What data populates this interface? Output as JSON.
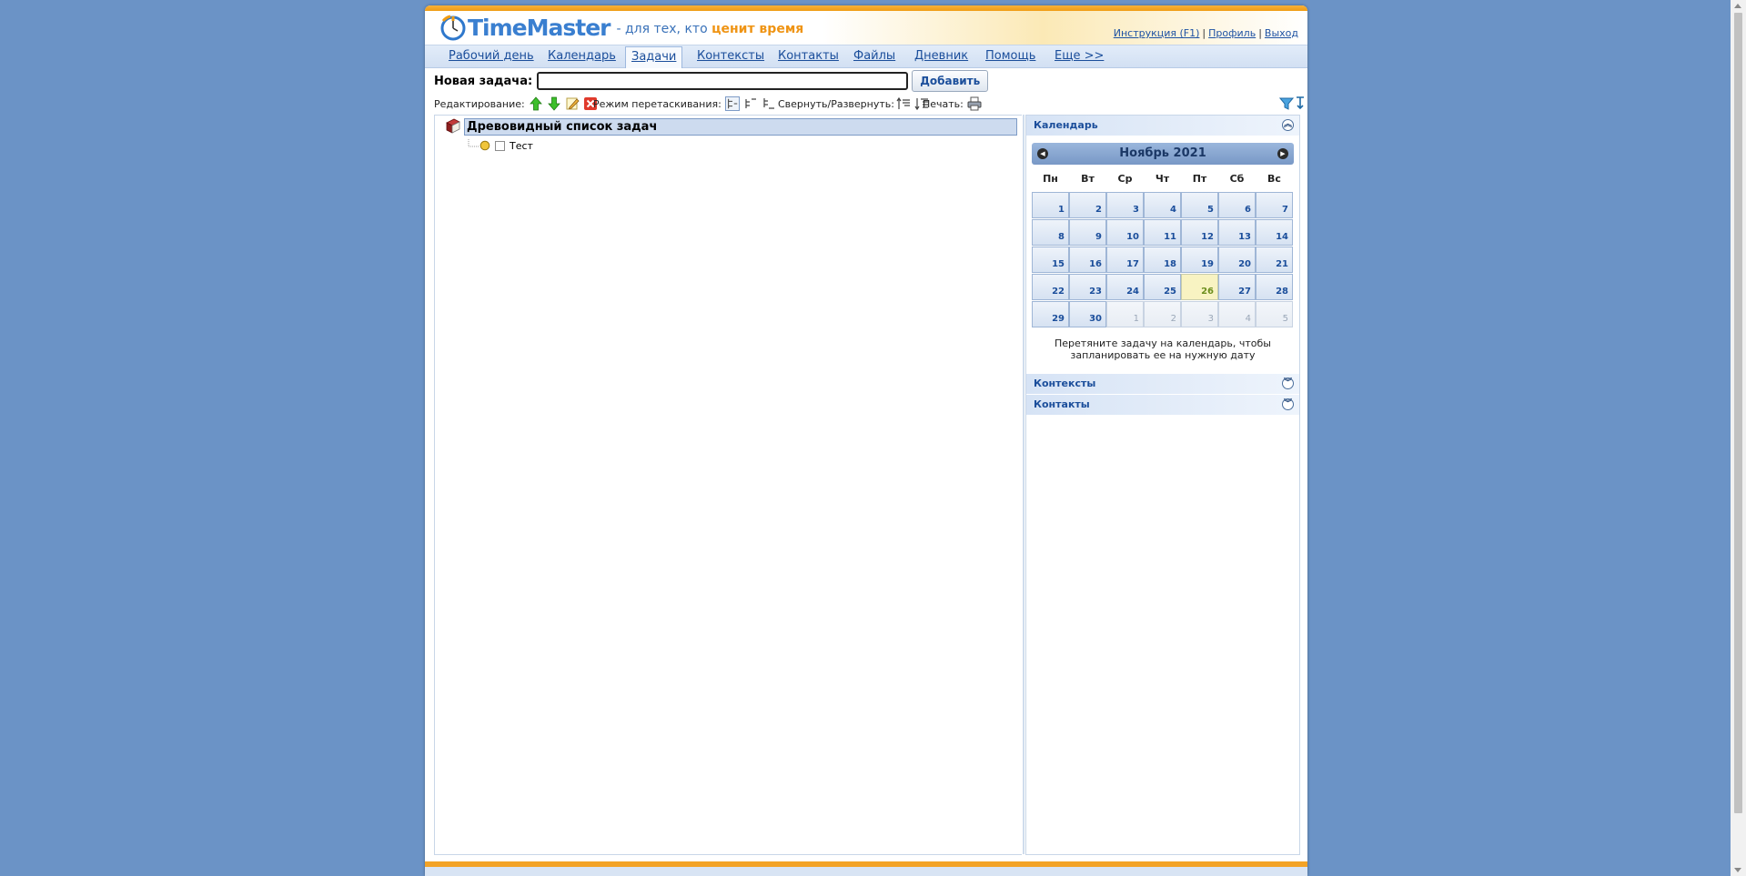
{
  "header": {
    "brand": "TimeMaster",
    "slogan_prefix": "- для тех, кто",
    "slogan_highlight": "ценит время",
    "links": {
      "help": "Инструкция (F1)",
      "profile": "Профиль",
      "logout": "Выход",
      "separator": "|"
    }
  },
  "nav": {
    "tabs": [
      {
        "label": "Рабочий день"
      },
      {
        "label": "Календарь"
      },
      {
        "label": "Задачи",
        "active": true
      },
      {
        "label": "Контексты"
      },
      {
        "label": "Контакты"
      },
      {
        "label": "Файлы"
      },
      {
        "label": "Дневник"
      },
      {
        "label": "Помощь"
      },
      {
        "label": "Еще >>"
      }
    ]
  },
  "new_task": {
    "label": "Новая задача:",
    "value": "",
    "button": "Добавить"
  },
  "toolbar": {
    "editing_label": "Редактирование:",
    "editing_icons": [
      "arrow-up-icon",
      "arrow-down-icon",
      "edit-pencil-icon",
      "delete-icon"
    ],
    "drag_mode_label": "Режим перетаскивания:",
    "drag_mode_icons": [
      "drag-mode-sibling-icon",
      "drag-mode-child-icon",
      "drag-mode-after-icon"
    ],
    "collapse_label": "Свернуть/Развернуть:",
    "collapse_icons": [
      "collapse-all-icon",
      "expand-all-icon"
    ],
    "print_label": "Печать:",
    "print_icon": "printer-icon",
    "right_icons": [
      "filter-icon",
      "sort-icon"
    ]
  },
  "tree": {
    "root_title": "Древовидный список задач",
    "items": [
      {
        "title": "Тест",
        "checked": false
      }
    ]
  },
  "sidebar": {
    "calendar_title": "Календарь",
    "month_label": "Ноябрь 2021",
    "weekdays": [
      "Пн",
      "Вт",
      "Ср",
      "Чт",
      "Пт",
      "Сб",
      "Вс"
    ],
    "days": [
      {
        "n": "1"
      },
      {
        "n": "2"
      },
      {
        "n": "3"
      },
      {
        "n": "4"
      },
      {
        "n": "5"
      },
      {
        "n": "6"
      },
      {
        "n": "7"
      },
      {
        "n": "8"
      },
      {
        "n": "9"
      },
      {
        "n": "10"
      },
      {
        "n": "11"
      },
      {
        "n": "12"
      },
      {
        "n": "13"
      },
      {
        "n": "14"
      },
      {
        "n": "15"
      },
      {
        "n": "16"
      },
      {
        "n": "17"
      },
      {
        "n": "18"
      },
      {
        "n": "19"
      },
      {
        "n": "20"
      },
      {
        "n": "21"
      },
      {
        "n": "22"
      },
      {
        "n": "23"
      },
      {
        "n": "24"
      },
      {
        "n": "25"
      },
      {
        "n": "26",
        "today": true
      },
      {
        "n": "27"
      },
      {
        "n": "28"
      },
      {
        "n": "29"
      },
      {
        "n": "30"
      },
      {
        "n": "1",
        "other": true
      },
      {
        "n": "2",
        "other": true
      },
      {
        "n": "3",
        "other": true
      },
      {
        "n": "4",
        "other": true
      },
      {
        "n": "5",
        "other": true
      }
    ],
    "hint": "Перетяните задачу на календарь, чтобы запланировать ее на нужную дату",
    "contexts_title": "Контексты",
    "contacts_title": "Контакты"
  },
  "colors": {
    "accent_orange": "#ef9c14",
    "link_blue": "#1b4e9b",
    "page_bg": "#6b93c6",
    "today_bg": "#f8f3c2"
  }
}
